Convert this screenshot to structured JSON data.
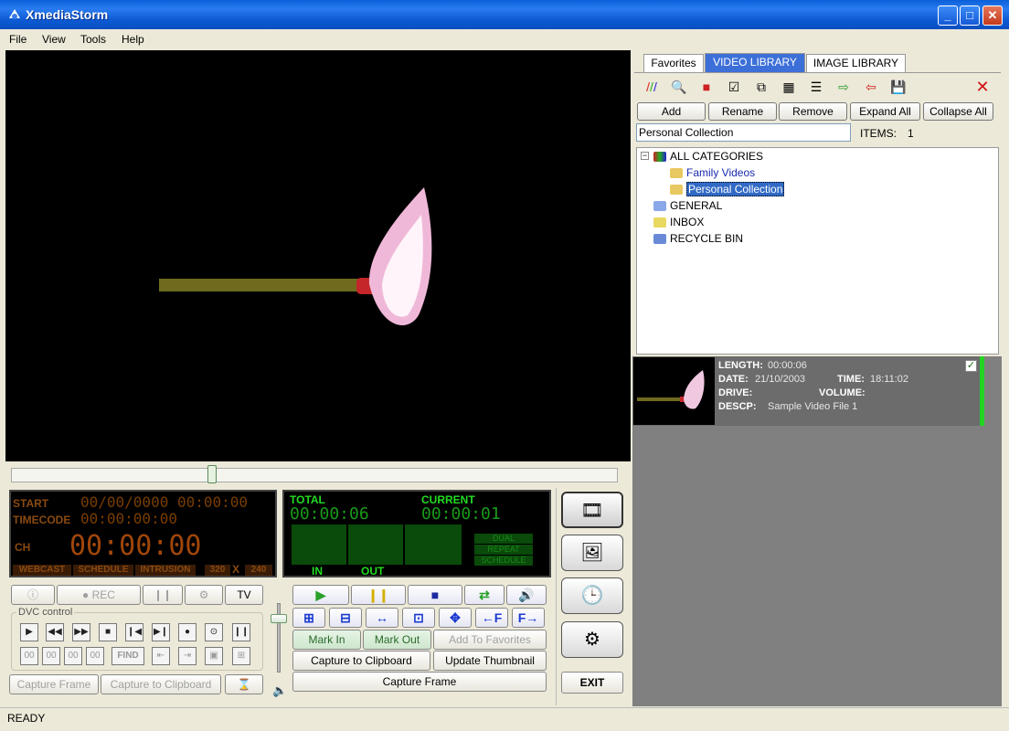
{
  "window": {
    "title": "XmediaStorm"
  },
  "menu": [
    "File",
    "View",
    "Tools",
    "Help"
  ],
  "lcd": {
    "start_label": "START",
    "start_value": "00/00/0000 00:00:00",
    "timecode_label": "TIMECODE",
    "timecode_value": "00:00:00:00",
    "ch_label": "CH",
    "ch_value": "00:00:00",
    "flags": [
      "WEBCAST",
      "SCHEDULE",
      "INTRUSION"
    ],
    "res_w": "320",
    "res_x": "X",
    "res_h": "240"
  },
  "counter": {
    "total_label": "TOTAL",
    "total_value": "00:00:06",
    "current_label": "CURRENT",
    "current_value": "00:00:01",
    "in_label": "IN",
    "out_label": "OUT",
    "modes": [
      "DUAL",
      "REPEAT",
      "SCHEDULE"
    ]
  },
  "record": {
    "rec": "REC",
    "tv": "TV"
  },
  "dvc": {
    "label": "DVC control",
    "time": [
      "00",
      "00",
      "00",
      "00"
    ],
    "find": "FIND",
    "capture_frame": "Capture Frame",
    "capture_clipboard": "Capture to Clipboard"
  },
  "player": {
    "mark_in": "Mark In",
    "mark_out": "Mark Out",
    "add_favorites": "Add To Favorites",
    "capture_clipboard": "Capture to Clipboard",
    "update_thumbnail": "Update Thumbnail",
    "capture_frame": "Capture Frame"
  },
  "side": {
    "exit": "EXIT"
  },
  "library": {
    "tabs": [
      "Favorites",
      "VIDEO LIBRARY",
      "IMAGE LIBRARY"
    ],
    "buttons": [
      "Add",
      "Rename",
      "Remove",
      "Expand All",
      "Collapse All"
    ],
    "selected_name": "Personal Collection",
    "items_label": "ITEMS:",
    "items_count": "1",
    "tree": {
      "root": "ALL CATEGORIES",
      "child1": "Family Videos",
      "child2": "Personal Collection",
      "general": "GENERAL",
      "inbox": "INBOX",
      "recycle": "RECYCLE BIN"
    }
  },
  "video_item": {
    "length_label": "LENGTH:",
    "length": "00:00:06",
    "date_label": "DATE:",
    "date": "21/10/2003",
    "time_label": "TIME:",
    "time": "18:11:02",
    "drive_label": "DRIVE:",
    "volume_label": "VOLUME:",
    "descp_label": "DESCP:",
    "descp": "Sample Video File 1"
  },
  "status": {
    "text": "READY"
  }
}
